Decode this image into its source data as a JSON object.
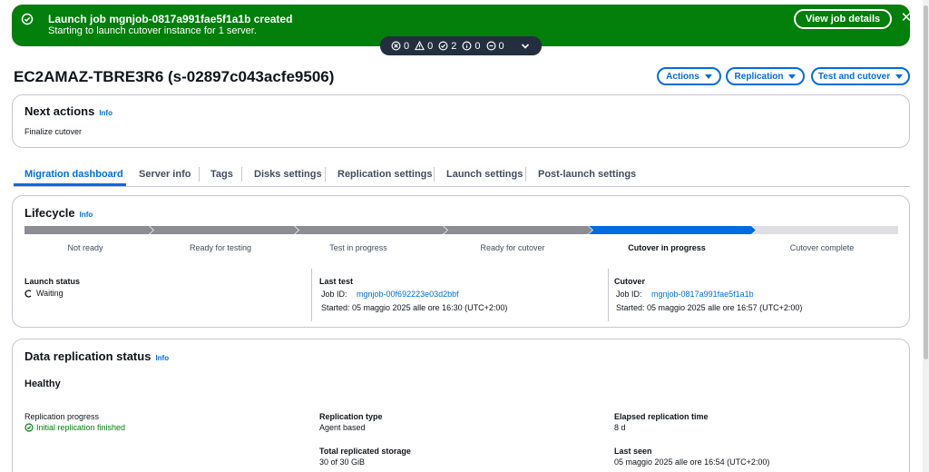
{
  "flash": {
    "title": "Launch job mgnjob-0817a991fae5f1a1b created",
    "message": "Starting to launch cutover instance for 1 server.",
    "view_button": "View job details",
    "close": "✕",
    "bg_color": "#037f0c"
  },
  "counters": {
    "error": "0",
    "warning": "0",
    "success": "2",
    "info": "0",
    "in_progress": "0"
  },
  "header": {
    "title": "EC2AMAZ-TBRE3R6 (s-02897c043acfe9506)",
    "actions": "Actions",
    "replication": "Replication",
    "test_cutover": "Test and cutover"
  },
  "next_actions": {
    "title": "Next actions",
    "info": "Info",
    "text": "Finalize cutover"
  },
  "tabs": [
    {
      "label": "Migration dashboard"
    },
    {
      "label": "Server info"
    },
    {
      "label": "Tags"
    },
    {
      "label": "Disks settings"
    },
    {
      "label": "Replication settings"
    },
    {
      "label": "Launch settings"
    },
    {
      "label": "Post-launch settings"
    }
  ],
  "lifecycle": {
    "title": "Lifecycle",
    "info": "Info",
    "steps": [
      {
        "label": "Not ready"
      },
      {
        "label": "Ready for testing"
      },
      {
        "label": "Test in progress"
      },
      {
        "label": "Ready for cutover"
      },
      {
        "label": "Cutover in progress"
      },
      {
        "label": "Cutover complete"
      }
    ],
    "current_step": "Cutover in progress",
    "colors": {
      "done": "#8c8c94",
      "current": "#006ce0",
      "pending": "#dedee3"
    },
    "launch_status": {
      "label": "Launch status",
      "value": "Waiting"
    },
    "last_test": {
      "label": "Last test",
      "job_label": "Job ID:",
      "job_id": "mgnjob-00f692223e03d2bbf",
      "started": "Started: 05 maggio 2025 alle ore 16:30 (UTC+2:00)"
    },
    "cutover": {
      "label": "Cutover",
      "job_label": "Job ID:",
      "job_id": "mgnjob-0817a991fae5f1a1b",
      "started": "Started: 05 maggio 2025 alle ore 16:57 (UTC+2:00)"
    }
  },
  "replication": {
    "title": "Data replication status",
    "info": "Info",
    "health": "Healthy",
    "progress_label": "Replication progress",
    "progress_value": "Initial replication finished",
    "type_label": "Replication type",
    "type_value": "Agent based",
    "elapsed_label": "Elapsed replication time",
    "elapsed_value": "8 d",
    "storage_label": "Total replicated storage",
    "storage_value": "30 of 30 GiB",
    "last_seen_label": "Last seen",
    "last_seen_value": "05 maggio 2025 alle ore 16:54 (UTC+2:00)"
  }
}
